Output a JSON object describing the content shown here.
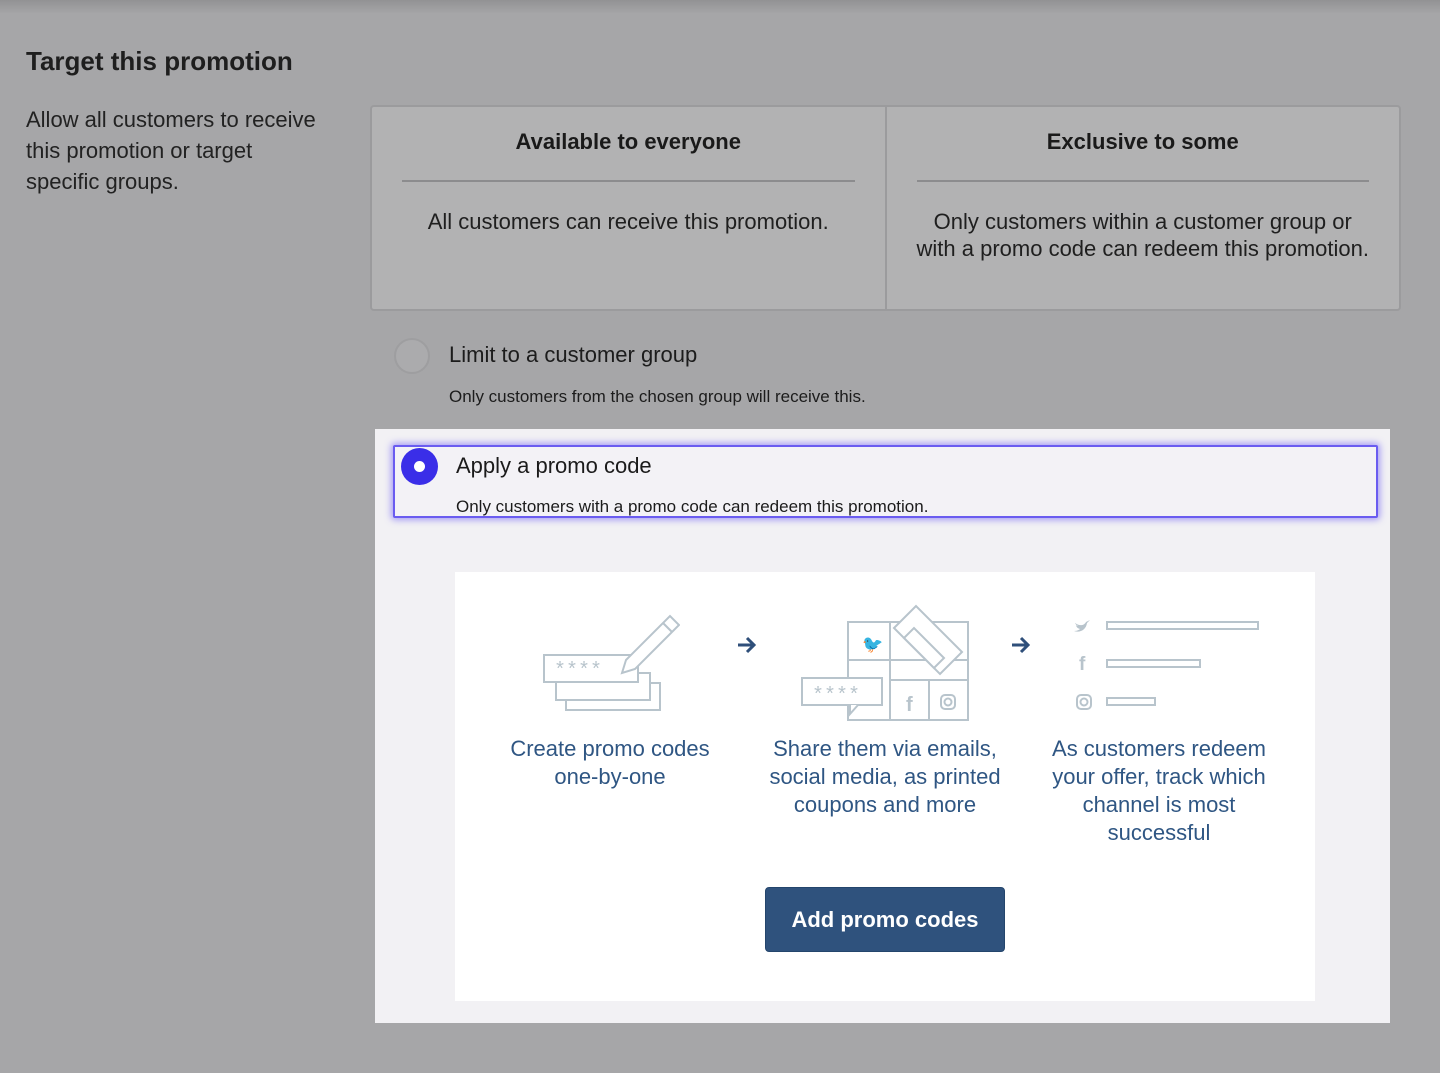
{
  "section": {
    "title": "Target this promotion",
    "description": "Allow all customers to receive this promotion or target specific groups."
  },
  "options": [
    {
      "title": "Available to everyone",
      "body": "All customers can receive this promotion."
    },
    {
      "title": "Exclusive to some",
      "body": "Only customers within a customer group or with a promo code can redeem this promotion."
    }
  ],
  "radios": {
    "customer_group": {
      "label": "Limit to a customer group",
      "sub": "Only customers from the chosen group will receive this.",
      "selected": false
    },
    "promo_code": {
      "label": "Apply a promo code",
      "sub": "Only customers with a promo code can redeem this promotion.",
      "selected": true
    }
  },
  "promo_card": {
    "steps": [
      {
        "text": "Create promo codes one-by-one",
        "icon": "promo-codes-pencil-icon"
      },
      {
        "text": "Share them via emails, social media, as printed coupons and more",
        "icon": "share-coupons-icon"
      },
      {
        "text": "As customers redeem your offer, track which channel is most successful",
        "icon": "channel-tracking-icon"
      }
    ],
    "button_label": "Add promo codes",
    "code_mask": "****"
  },
  "colors": {
    "accent": "#3a2ee8",
    "button": "#2f527d",
    "step_text": "#2f5683",
    "icon_stroke": "#b8c4cc"
  }
}
